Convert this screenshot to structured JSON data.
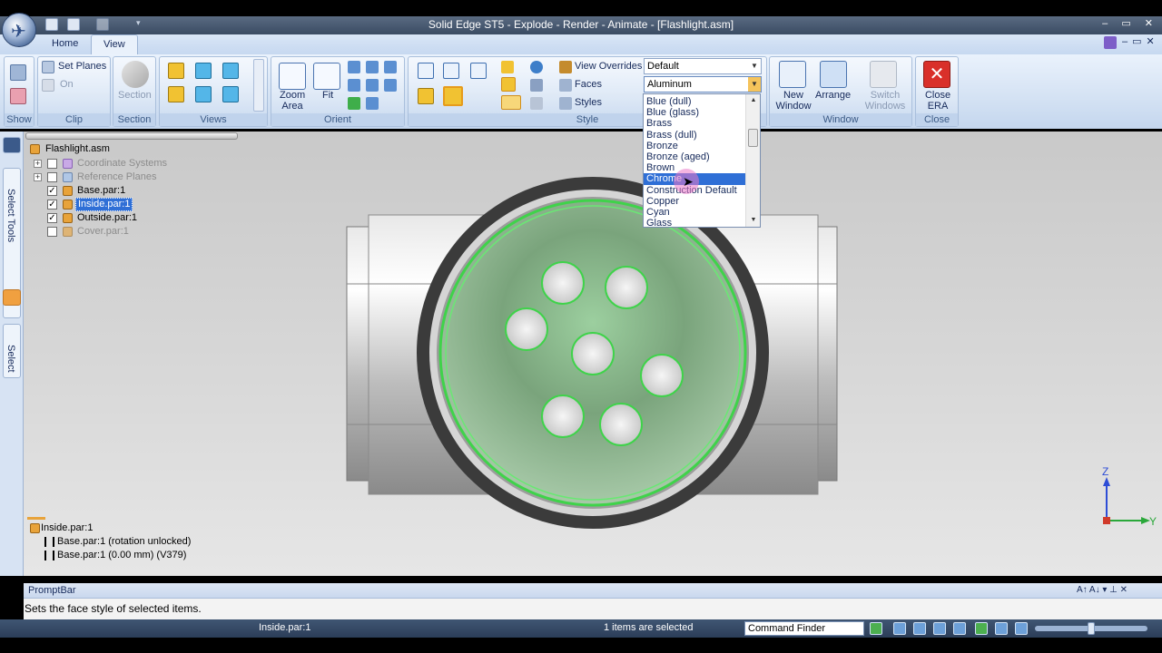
{
  "window": {
    "title": "Solid Edge ST5 - Explode - Render - Animate - [Flashlight.asm]",
    "controls": "– ▭ ✕"
  },
  "tabs": [
    {
      "label": "Home"
    },
    {
      "label": "View"
    }
  ],
  "ribbon": {
    "show": {
      "label": "Show"
    },
    "clip": {
      "label": "Clip",
      "set_planes": "Set Planes",
      "on": "On"
    },
    "section": {
      "label": "Section",
      "button": "Section"
    },
    "views": {
      "label": "Views"
    },
    "orient": {
      "label": "Orient",
      "zoom_area": "Zoom Area",
      "fit": "Fit"
    },
    "style": {
      "label": "Style",
      "view_overrides": "View Overrides",
      "faces": "Faces",
      "styles": "Styles",
      "view_overrides_value": "Default",
      "faces_value": "Aluminum"
    },
    "window": {
      "label": "Window",
      "new_window": "New Window",
      "arrange": "Arrange",
      "switch_windows": "Switch Windows"
    },
    "close": {
      "label": "Close",
      "close_era": "Close ERA"
    }
  },
  "face_dropdown": {
    "options": [
      "Blue (dull)",
      "Blue (glass)",
      "Brass",
      "Brass (dull)",
      "Bronze",
      "Bronze (aged)",
      "Brown",
      "Chrome",
      "Construction Default",
      "Copper",
      "Cyan",
      "Glass"
    ],
    "highlighted": "Chrome"
  },
  "pathfinder": {
    "root": "Flashlight.asm",
    "items": [
      {
        "label": "Coordinate Systems",
        "checked": false,
        "disabled": true
      },
      {
        "label": "Reference Planes",
        "checked": false,
        "disabled": true
      },
      {
        "label": "Base.par:1",
        "checked": true,
        "disabled": false
      },
      {
        "label": "Inside.par:1",
        "checked": true,
        "selected": true
      },
      {
        "label": "Outside.par:1",
        "checked": true,
        "disabled": false
      },
      {
        "label": "Cover.par:1",
        "checked": false,
        "disabled": true
      }
    ]
  },
  "side_tabs": {
    "select_tools": "Select Tools",
    "select": "Select"
  },
  "relationships": {
    "part": "Inside.par:1",
    "rows": [
      "Base.par:1   (rotation unlocked)",
      "Base.par:1   (0.00 mm)   (V379)"
    ]
  },
  "triad": {
    "z": "Z",
    "y": "Y"
  },
  "promptbar": {
    "title": "PromptBar",
    "message": "Sets the face style of selected items.",
    "controls": "A↑ A↓ ▾ ⊥ ✕"
  },
  "status": {
    "active_part": "Inside.par:1",
    "selection": "1 items are selected",
    "command_finder": "Command Finder"
  },
  "colors": {
    "selection_green": "#3fd34a",
    "accent_blue": "#2f6fd6",
    "ribbon_bg": "#d0dff2",
    "close_red": "#d9302a"
  }
}
